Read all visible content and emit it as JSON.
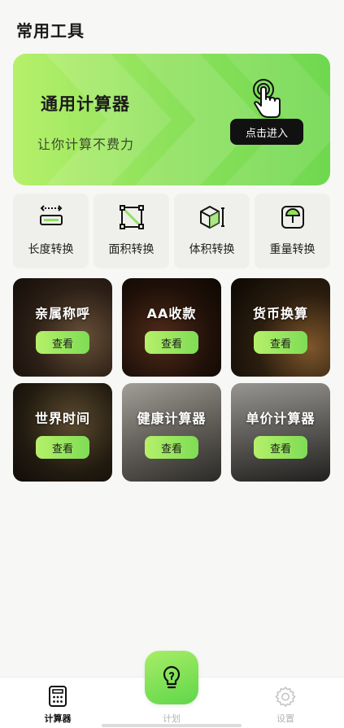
{
  "header": {
    "title": "常用工具"
  },
  "hero": {
    "title": "通用计算器",
    "subtitle": "让你计算不费力",
    "button_label": "点击进入",
    "icon": "tap-hand-icon"
  },
  "converters": [
    {
      "label": "长度转换",
      "icon": "ruler-icon"
    },
    {
      "label": "面积转换",
      "icon": "area-icon"
    },
    {
      "label": "体积转换",
      "icon": "cube-icon"
    },
    {
      "label": "重量转换",
      "icon": "scale-icon"
    }
  ],
  "tools": [
    {
      "title": "亲属称呼",
      "button": "查看"
    },
    {
      "title": "AA收款",
      "button": "查看"
    },
    {
      "title": "货币换算",
      "button": "查看"
    },
    {
      "title": "世界时间",
      "button": "查看"
    },
    {
      "title": "健康计算器",
      "button": "查看"
    },
    {
      "title": "单价计算器",
      "button": "查看"
    }
  ],
  "tabbar": {
    "calculator": "计算器",
    "plan": "计划",
    "settings": "设置"
  },
  "colors": {
    "accent": "#7fdc55",
    "accent_light": "#b6f06a",
    "dark": "#111111"
  }
}
